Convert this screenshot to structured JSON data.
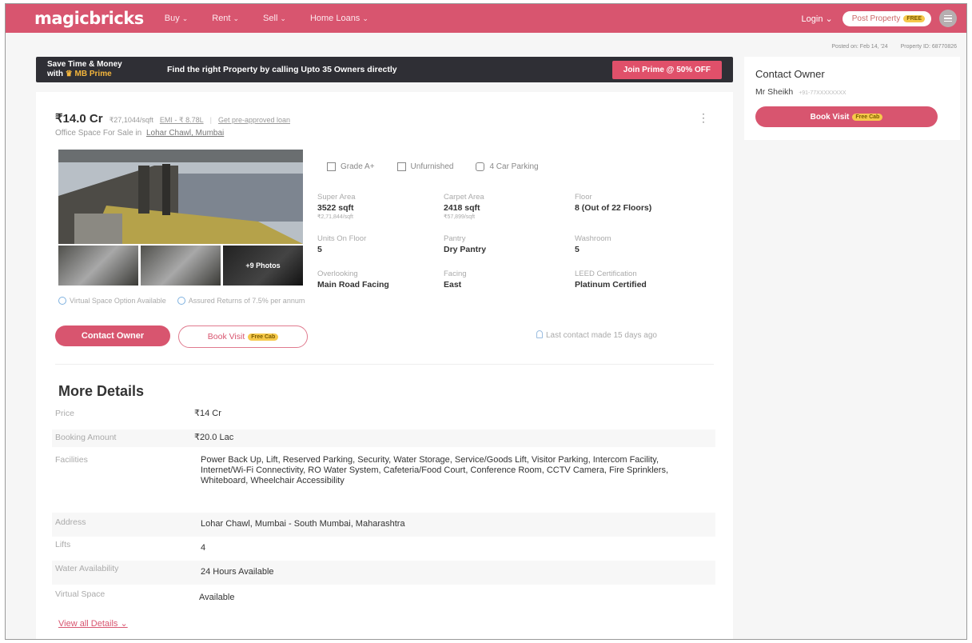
{
  "nav": {
    "logo": "magicbricks",
    "links": [
      "Buy",
      "Rent",
      "Sell",
      "Home Loans"
    ],
    "login": "Login",
    "post_property": "Post Property",
    "free_badge": "FREE"
  },
  "meta": {
    "posted": "Posted on: Feb 14, '24",
    "property_id": "Property ID: 68770826"
  },
  "prime_banner": {
    "line1": "Save Time & Money",
    "line2_prefix": "with",
    "line2_brand": "MB Prime",
    "message": "Find the right Property by calling Upto 35 Owners directly",
    "cta": "Join Prime @ 50% OFF"
  },
  "listing": {
    "price": "₹14.0 Cr",
    "price_per_sqft": "₹27,1044/sqft",
    "emi": "EMI - ₹ 8.78L",
    "separator": "|",
    "loan_link": "Get pre-approved loan",
    "subtitle_prefix": "Office Space For Sale in",
    "location": "Lohar Chawl, Mumbai",
    "photo_count": "+9 Photos",
    "badges": [
      "Grade A+",
      "Unfurnished",
      "4 Car Parking"
    ],
    "specs": [
      {
        "label": "Super Area",
        "value": "3522 sqft",
        "sub": "₹2,71,844/sqft"
      },
      {
        "label": "Carpet Area",
        "value": "2418 sqft",
        "sub": "₹57,899/sqft"
      },
      {
        "label": "Floor",
        "value": "8 (Out of 22 Floors)",
        "sub": ""
      },
      {
        "label": "Units On Floor",
        "value": "5",
        "sub": ""
      },
      {
        "label": "Pantry",
        "value": "Dry Pantry",
        "sub": ""
      },
      {
        "label": "Washroom",
        "value": "5",
        "sub": ""
      },
      {
        "label": "Overlooking",
        "value": "Main Road Facing",
        "sub": ""
      },
      {
        "label": "Facing",
        "value": "East",
        "sub": ""
      },
      {
        "label": "LEED Certification",
        "value": "Platinum Certified",
        "sub": ""
      }
    ],
    "assurances": [
      "Virtual Space Option Available",
      "Assured Returns of 7.5% per annum"
    ],
    "contact_button": "Contact Owner",
    "visit_button": "Book Visit",
    "free_cab": "Free Cab",
    "last_contact": "Last contact made 15 days ago"
  },
  "more_details": {
    "title": "More Details",
    "rows": [
      {
        "label": "Price",
        "value": "₹14 Cr"
      },
      {
        "label": "Booking Amount",
        "value": "₹20.0 Lac"
      },
      {
        "label": "Facilities",
        "value": "Power Back Up, Lift, Reserved Parking, Security, Water Storage, Service/Goods Lift, Visitor Parking, Intercom Facility, Internet/Wi-Fi Connectivity, RO Water System, Cafeteria/Food Court, Conference Room, CCTV Camera, Fire Sprinklers, Whiteboard, Wheelchair Accessibility"
      },
      {
        "label": "Address",
        "value": "Lohar Chawl, Mumbai - South Mumbai, Maharashtra"
      },
      {
        "label": "Lifts",
        "value": "4"
      },
      {
        "label": "Water Availability",
        "value": "24 Hours Available"
      },
      {
        "label": "Virtual Space",
        "value": "Available"
      }
    ],
    "view_all": "View all Details"
  },
  "sidebar": {
    "title": "Contact Owner",
    "owner_name": "Mr Sheikh",
    "owner_phone": "+91-77XXXXXXXX",
    "book_visit": "Book Visit",
    "free_cab": "Free Cab"
  }
}
